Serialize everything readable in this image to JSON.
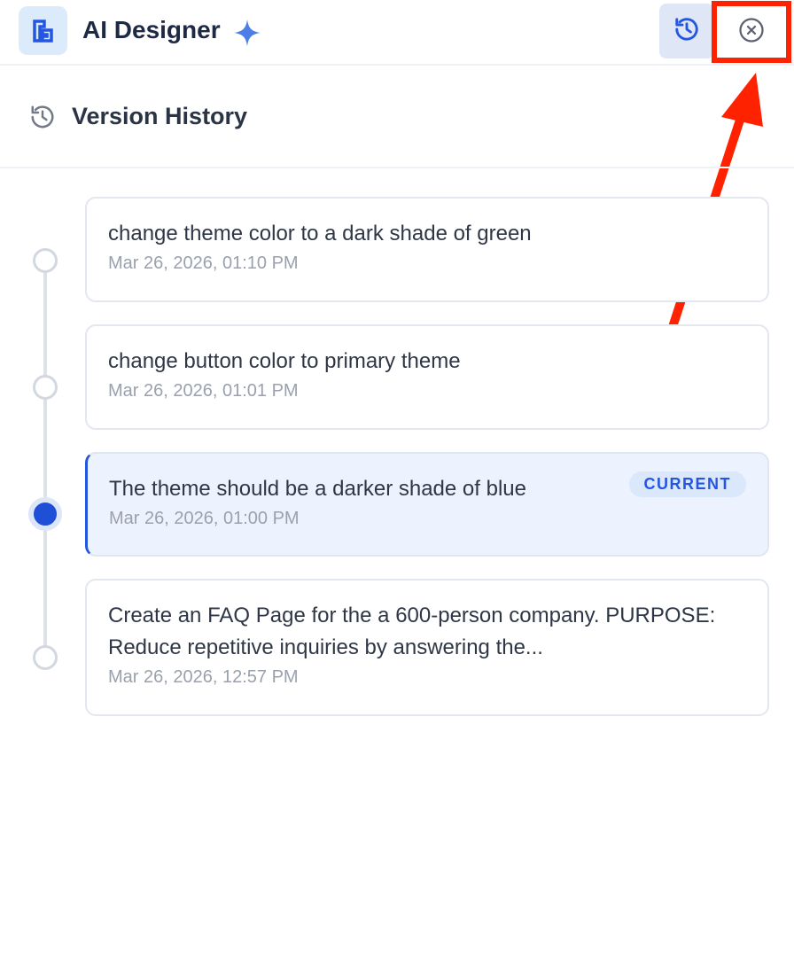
{
  "app": {
    "title": "AI Designer",
    "logo_icon": "app-logo-icon",
    "sparkle_icon": "sparkle-icon"
  },
  "toolbar": {
    "history_icon": "history-icon",
    "close_icon": "close-circle-icon"
  },
  "panel": {
    "title": "Version History",
    "title_icon": "history-icon"
  },
  "versions": [
    {
      "title": "change theme color to a dark shade of green",
      "time": "Mar 26, 2026, 01:10 PM",
      "current": false
    },
    {
      "title": "change button color to primary theme",
      "time": "Mar 26, 2026, 01:01 PM",
      "current": false
    },
    {
      "title": "The theme should be a darker shade of blue",
      "time": "Mar 26, 2026, 01:00 PM",
      "current": true,
      "badge": "CURRENT"
    },
    {
      "title": "Create an FAQ Page for the a 600-person company. PURPOSE: Reduce repetitive inquiries by answering the...",
      "time": "Mar 26, 2026, 12:57 PM",
      "current": false
    }
  ],
  "colors": {
    "accent": "#2456e0",
    "current_bg": "#edf3fe",
    "annotation": "#ff2200"
  }
}
